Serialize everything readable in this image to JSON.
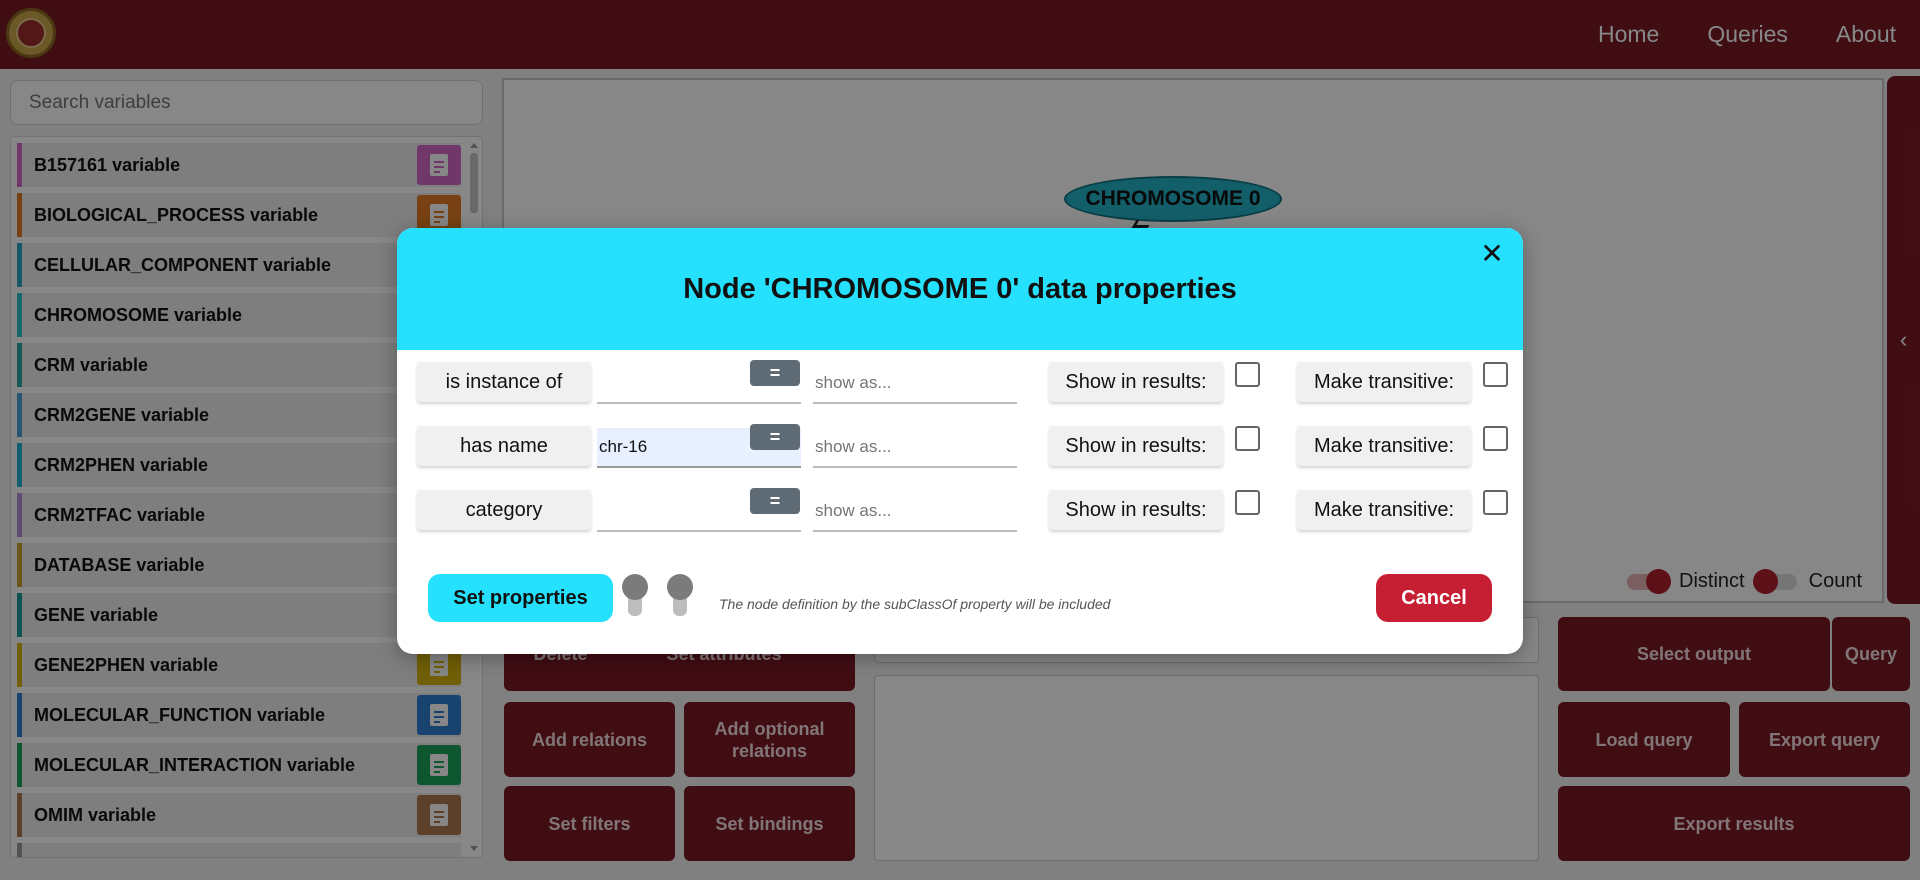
{
  "nav": {
    "home": "Home",
    "queries": "Queries",
    "about": "About"
  },
  "search": {
    "placeholder": "Search variables"
  },
  "variables": [
    {
      "label": "B157161 variable",
      "color": "#d46bc7"
    },
    {
      "label": "BIOLOGICAL_PROCESS variable",
      "color": "#e07b25"
    },
    {
      "label": "CELLULAR_COMPONENT variable",
      "color": "#2aa6c4"
    },
    {
      "label": "CHROMOSOME variable",
      "color": "#2ac4cf"
    },
    {
      "label": "CRM variable",
      "color": "#2aa6a6"
    },
    {
      "label": "CRM2GENE variable",
      "color": "#4aa3d8"
    },
    {
      "label": "CRM2PHEN variable",
      "color": "#1db3d8"
    },
    {
      "label": "CRM2TFAC variable",
      "color": "#b38fdc"
    },
    {
      "label": "DATABASE variable",
      "color": "#c9a227"
    },
    {
      "label": "GENE variable",
      "color": "#1a9d9d"
    },
    {
      "label": "GENE2PHEN variable",
      "color": "#d8b40a"
    },
    {
      "label": "MOLECULAR_FUNCTION variable",
      "color": "#2d7fd0"
    },
    {
      "label": "MOLECULAR_INTERACTION variable",
      "color": "#1aa35c"
    },
    {
      "label": "OMIM variable",
      "color": "#b07a50"
    }
  ],
  "canvas": {
    "node_label": "CHROMOSOME 0",
    "distinct_label": "Distinct",
    "count_label": "Count",
    "distinct_on": true,
    "count_on": false
  },
  "buttons": {
    "delete": "Delete",
    "set_attributes": "Set attributes",
    "add_relations": "Add relations",
    "add_optional_relations": "Add optional relations",
    "set_filters": "Set filters",
    "set_bindings": "Set bindings",
    "select_output": "Select output",
    "query": "Query",
    "load_query": "Load query",
    "export_query": "Export query",
    "export_results": "Export results"
  },
  "modal": {
    "title": "Node 'CHROMOSOME 0' data properties",
    "operator": "=",
    "showas_placeholder": "show as...",
    "show_in_results_label": "Show in results:",
    "make_transitive_label": "Make transitive:",
    "properties": [
      {
        "name": "is instance of",
        "value": "",
        "show_in_results": false,
        "make_transitive": false
      },
      {
        "name": "has name",
        "value": "chr-16",
        "show_in_results": false,
        "make_transitive": false
      },
      {
        "name": "category",
        "value": "",
        "show_in_results": false,
        "make_transitive": false
      }
    ],
    "set_properties": "Set properties",
    "note": "The node definition by the subClassOf property will be included",
    "cancel": "Cancel"
  },
  "colors": {
    "brand": "#7a1a25",
    "accent": "#25e1fd",
    "cancel": "#c61f33",
    "node": "#23b1c6"
  }
}
